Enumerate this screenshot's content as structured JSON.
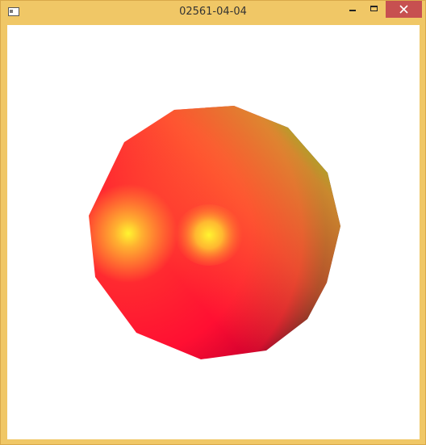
{
  "window": {
    "title": "02561-04-04"
  },
  "titlebar": {
    "icon": "window-app-icon",
    "buttons": [
      "minimize-icon",
      "maximize-icon",
      "close-icon"
    ],
    "close_color": "#c75050",
    "frame_color": "#f0c766"
  },
  "scene": {
    "object": "sphere",
    "colors": {
      "highlight": "#fff530",
      "base": "#ff1530",
      "mid": "#ff8a30",
      "rim": "#80cc20",
      "shadow": "#5a0024"
    }
  }
}
